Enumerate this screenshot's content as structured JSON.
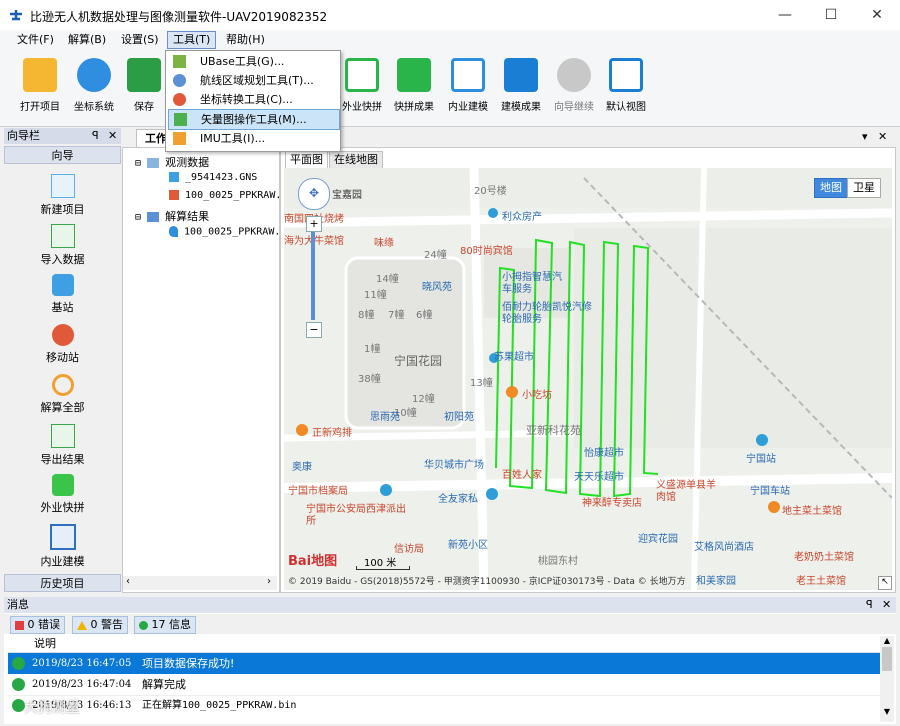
{
  "app": {
    "title": "比逊无人机数据处理与图像测量软件-UAV2019082352"
  },
  "window_controls": {
    "minimize": "—",
    "maximize": "☐",
    "close": "✕"
  },
  "menubar": [
    "文件(F)",
    "解算(B)",
    "设置(S)",
    "工具(T)",
    "帮助(H)"
  ],
  "toolbar": [
    {
      "label": "打开项目",
      "icon": "folder-icon",
      "color": "#f5b731"
    },
    {
      "label": "坐标系统",
      "icon": "globe-icon",
      "color": "#2f8ee0"
    },
    {
      "label": "保存",
      "icon": "save-icon",
      "color": "#2a9d46"
    },
    {
      "label": "外业快拼",
      "icon": "network-icon",
      "color": "#29b54a"
    },
    {
      "label": "快拼成果",
      "icon": "image-search-icon",
      "color": "#29b54a"
    },
    {
      "label": "内业建模",
      "icon": "model-icon",
      "color": "#2f8ee0"
    },
    {
      "label": "建模成果",
      "icon": "cube-icon",
      "color": "#1a7fd4"
    },
    {
      "label": "向导继续",
      "icon": "download-icon",
      "color": "#b0b0b0"
    },
    {
      "label": "默认视图",
      "icon": "layout-icon",
      "color": "#1a7fd4"
    }
  ],
  "tools_menu": [
    {
      "label": "UBase工具(G)...",
      "icon": "ubase-icon"
    },
    {
      "label": "航线区域规划工具(T)...",
      "icon": "route-plan-icon"
    },
    {
      "label": "坐标转换工具(C)...",
      "icon": "coord-convert-icon"
    },
    {
      "label": "矢量图操作工具(M)...",
      "icon": "vector-tool-icon"
    },
    {
      "label": "IMU工具(I)...",
      "icon": "imu-icon"
    }
  ],
  "nav": {
    "title": "向导栏",
    "pin": "ꟼ",
    "close": "✕",
    "header": "向导",
    "items": [
      {
        "label": "新建项目",
        "icon": "new-project-icon"
      },
      {
        "label": "导入数据",
        "icon": "import-icon"
      },
      {
        "label": "基站",
        "icon": "base-station-icon"
      },
      {
        "label": "移动站",
        "icon": "rover-icon"
      },
      {
        "label": "解算全部",
        "icon": "solve-all-icon"
      },
      {
        "label": "导出结果",
        "icon": "export-icon"
      },
      {
        "label": "外业快拼",
        "icon": "field-mosaic-icon"
      },
      {
        "label": "内业建模",
        "icon": "office-model-icon"
      }
    ],
    "footer": "历史项目"
  },
  "workspace": {
    "tab": "工作",
    "arrow": "▾",
    "close": "✕"
  },
  "tree": {
    "root1": "观测数据",
    "child1": "_9541423.GNS",
    "child2": "100_0025_PPKRAW.",
    "root2": "解算结果",
    "child3": "100_0025_PPKRAW."
  },
  "map": {
    "tabs": [
      "平面图",
      "在线地图"
    ],
    "map_type": [
      "地图",
      "卫星"
    ],
    "zoom_in": "+",
    "zoom_out": "−",
    "scale": "100 米",
    "copyright": "© 2019 Baidu - GS(2018)5572号 - 甲测资字1100930 - 京ICP证030173号 - Data © 长地万方",
    "baidu_logo": "Bai地图",
    "labels": [
      "宝嘉园",
      "20号楼",
      "利众房产",
      "南国四社烧烤",
      "海为大牛菜馆",
      "味缘",
      "24幢",
      "80时尚宾馆",
      "14幢",
      "11幢",
      "晓风苑",
      "8幢",
      "7幢",
      "6幢",
      "1幢",
      "宁国花园",
      "38幢",
      "12幢",
      "10幢",
      "初阳苑",
      "思雨苑",
      "13幢",
      "小拇指智慧汽车服务",
      "佰耐力轮胎凯悦汽修轮胎服务",
      "苏果超市",
      "小吃坊",
      "正新鸡排",
      "亚新科花苑",
      "怡康超市",
      "奥康",
      "华贝城市广场",
      "百姓人家",
      "天天乐超市",
      "宁国站",
      "宁国车站",
      "宁国市档案局",
      "全友家私",
      "神来醉专卖店",
      "义盛源单县羊肉馆",
      "地主菜土菜馆",
      "宁国市公安局西津派出所",
      "迎宾花园",
      "艾格风尚酒店",
      "老奶奶土菜馆",
      "信访局",
      "新苑小区",
      "桃园东村",
      "老王土菜馆",
      "和美家园"
    ]
  },
  "messages": {
    "title": "消息",
    "pin": "ꟼ",
    "close": "✕",
    "filters": [
      {
        "label": "0 错误",
        "icon": "error-icon",
        "color": "#e04040"
      },
      {
        "label": "0 警告",
        "icon": "warning-icon",
        "color": "#f0b400"
      },
      {
        "label": "17 信息",
        "icon": "info-icon",
        "color": "#28a745"
      }
    ],
    "column_header": "说明",
    "rows": [
      {
        "time": "2019/8/23 16:47:05",
        "text": "项目数据保存成功!"
      },
      {
        "time": "2019/8/23 16:47:04",
        "text": "解算完成"
      },
      {
        "time": "2019/8/23 16:46:13",
        "text": "正在解算100_0025_PPKRAW.bin"
      }
    ],
    "scroll_up": "▲",
    "scroll_down": "▼",
    "watermark": "大狗测量"
  },
  "colors": {
    "flight_path": "#22e022",
    "selection": "#0a78d7",
    "highlight": "#cce4f7"
  }
}
